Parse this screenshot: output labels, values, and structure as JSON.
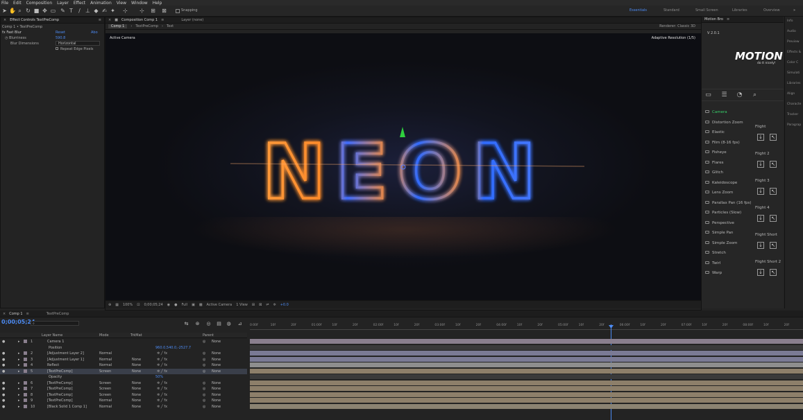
{
  "menu": [
    "File",
    "Edit",
    "Composition",
    "Layer",
    "Effect",
    "Animation",
    "View",
    "Window",
    "Help"
  ],
  "toolbar": {
    "snapping": "Snapping",
    "workspaces": [
      "Essentials",
      "Standard",
      "Small Screen",
      "Libraries",
      "Overview"
    ]
  },
  "effect_panel": {
    "tab": "Effect Controls TextPreComp",
    "breadcrumb": "Comp 1 • TextPreComp",
    "effect": "Fast Blur",
    "reset": "Reset",
    "about": "Abo",
    "blurriness_label": "Blurriness",
    "blurriness_value": "590.8",
    "dim_label": "Blur Dimensions",
    "dim_value": "Horizontal",
    "repeat_label": "Repeat Edge Pixels"
  },
  "comp_panel": {
    "tab": "Composition Comp 1",
    "layer_tab": "Layer (none)",
    "crumbs": [
      "Comp 1",
      "TextPreComp",
      "Text"
    ],
    "renderer": "Renderer: Classic 3D",
    "active_camera": "Active Camera",
    "adaptive": "Adaptive Resolution (1/5)",
    "neon_text": "NEON"
  },
  "viewer_bar": {
    "zoom": "100%",
    "time": "0;00;05;24",
    "quality": "Full",
    "camera": "Active Camera",
    "views": "1 View",
    "exposure": "+0.0"
  },
  "motion_bro": {
    "tab": "Motion Bro",
    "version": "V 2.0.1",
    "logo": "MOTION",
    "tagline": "do it nicely!",
    "categories": [
      "Camera",
      "Distortion Zoom",
      "Elastic",
      "Film (8-16 fps)",
      "Fisheye",
      "Flares",
      "Glitch",
      "Kaleidoscope",
      "Lens Zoom",
      "Parallax Pan (16 fps)",
      "Particles (Slow)",
      "Perspective",
      "Simple Pan",
      "Simple Zoom",
      "Stretch",
      "Twirl",
      "Warp"
    ],
    "presets": [
      "Flight",
      "Flight 2",
      "Flight 3",
      "Flight 4",
      "Flight Short",
      "Flight Short 2"
    ]
  },
  "right_panel": [
    "Info",
    "Audio",
    "Preview",
    "Effects &",
    "Color C",
    "Simulati",
    "Libraries",
    "Align",
    "Characte",
    "Tracker",
    "Paragrap"
  ],
  "timeline": {
    "tab": "Comp 1",
    "tab2": "TextPreComp",
    "timecode": "0;00;05;24",
    "headers": {
      "name": "Layer Name",
      "mode": "Mode",
      "trkmat": "TrkMat",
      "parent": "Parent"
    },
    "ruler": [
      "0:00f",
      "10f",
      "20f",
      "01:00f",
      "10f",
      "20f",
      "02:00f",
      "10f",
      "20f",
      "03:00f",
      "10f",
      "20f",
      "04:00f",
      "10f",
      "20f",
      "05:00f",
      "10f",
      "20f",
      "06:00f",
      "10f",
      "20f",
      "07:00f",
      "10f",
      "20f",
      "08:00f",
      "10f",
      "20f"
    ],
    "layers": [
      {
        "num": "1",
        "name": "Camera 1",
        "mode": "",
        "trk": "",
        "parent": "None"
      },
      {
        "num": "",
        "name": "Position",
        "mode": "",
        "trk": "",
        "parent": "",
        "sub": "960.0,540.0,-2527.7"
      },
      {
        "num": "2",
        "name": "[Adjustment Layer 2]",
        "mode": "Normal",
        "trk": "",
        "parent": "None"
      },
      {
        "num": "3",
        "name": "[Adjustment Layer 1]",
        "mode": "Normal",
        "trk": "None",
        "parent": "None"
      },
      {
        "num": "4",
        "name": "Reflect",
        "mode": "Normal",
        "trk": "None",
        "parent": "None"
      },
      {
        "num": "5",
        "name": "[TextPreComp]",
        "mode": "Screen",
        "trk": "None",
        "parent": "None"
      },
      {
        "num": "",
        "name": "Opacity",
        "mode": "",
        "trk": "",
        "parent": "",
        "sub": "50%"
      },
      {
        "num": "6",
        "name": "[TextPreComp]",
        "mode": "Screen",
        "trk": "None",
        "parent": "None"
      },
      {
        "num": "7",
        "name": "[TextPreComp]",
        "mode": "Screen",
        "trk": "None",
        "parent": "None"
      },
      {
        "num": "8",
        "name": "[TextPreComp]",
        "mode": "Screen",
        "trk": "None",
        "parent": "None"
      },
      {
        "num": "9",
        "name": "[TextPreComp]",
        "mode": "Normal",
        "trk": "None",
        "parent": "None"
      },
      {
        "num": "10",
        "name": "[Black Solid 1 Comp 1]",
        "mode": "Normal",
        "trk": "None",
        "parent": "None"
      }
    ]
  },
  "colors": {
    "accent": "#4d8cf5",
    "neon_orange": "#ff8a2a",
    "neon_blue": "#2f6bff",
    "green": "#37d06a"
  }
}
